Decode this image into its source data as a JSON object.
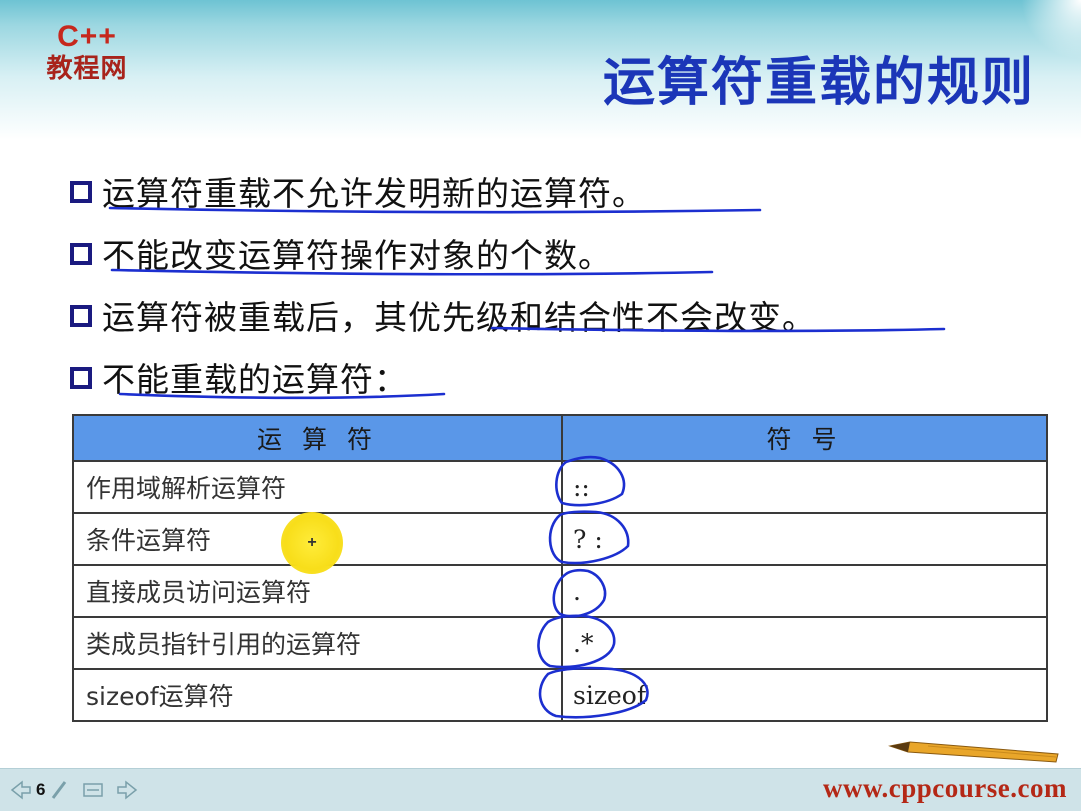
{
  "header": {
    "logo_top": "C++",
    "logo_bottom": "教程网",
    "title": "运算符重载的规则"
  },
  "bullets": [
    "运算符重载不允许发明新的运算符。",
    "不能改变运算符操作对象的个数。",
    "运算符被重载后，其优先级和结合性不会改变。",
    "不能重载的运算符："
  ],
  "table": {
    "headers": [
      "运 算 符",
      "符 号"
    ],
    "rows": [
      {
        "operator": "作用域解析运算符",
        "symbol": "::"
      },
      {
        "operator": "条件运算符",
        "symbol": "? :"
      },
      {
        "operator": "直接成员访问运算符",
        "symbol": "."
      },
      {
        "operator": "类成员指针引用的运算符",
        "symbol": ".*"
      },
      {
        "operator": "sizeof运算符",
        "symbol": "sizeof"
      }
    ]
  },
  "cursor": {
    "glyph": "+"
  },
  "footer": {
    "page_number": "6",
    "site_url": "www.cppcourse.com"
  },
  "colors": {
    "title_blue": "#1b36b8",
    "logo_red": "#c6281d",
    "table_header_blue": "#5a97e8",
    "ink_blue": "#1c2fd0",
    "url_red": "#b42816"
  },
  "icons": [
    "prev-arrow-icon",
    "pen-icon",
    "menu-icon",
    "next-arrow-icon",
    "pencil-icon",
    "checkbox-icon"
  ]
}
